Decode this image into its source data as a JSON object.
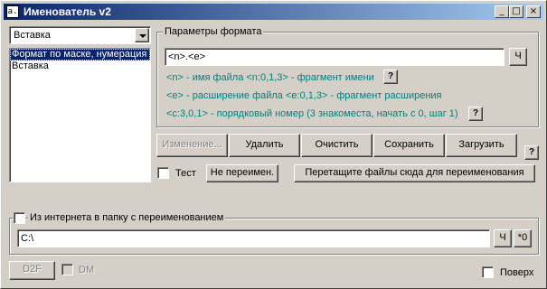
{
  "window": {
    "title": "Именователь v2",
    "icon": "app-icon",
    "icon_glyph": "a.",
    "controls": {
      "minimize": "_",
      "maximize": "□",
      "close": "×"
    }
  },
  "mode_select": {
    "value": "Вставка"
  },
  "mode_list": {
    "items": [
      {
        "label": "Формат по маске, нумерация",
        "selected": true
      },
      {
        "label": "Вставка",
        "selected": false
      }
    ]
  },
  "format_group": {
    "title": "Параметры формата",
    "mask_value": "<n>.<e>",
    "mask_button": "Ч",
    "hints": [
      {
        "text": "<n> - имя файла  <n:0,1,3> - фрагмент имени",
        "help": "?"
      },
      {
        "text": "<e> - расширение файла  <e:0,1,3> - фрагмент расширения",
        "help": ""
      },
      {
        "text": "<c:3,0,1> - порядковый номер (3 знакоместа, начать с 0, шаг 1)",
        "help": "?"
      }
    ],
    "hint_color": "#008080"
  },
  "actions": {
    "change": "Изменение...",
    "delete": "Удалить",
    "clear": "Очистить",
    "save": "Сохранить",
    "load": "Загрузить",
    "help": "?"
  },
  "test_checkbox": {
    "label": "Тест",
    "checked": false
  },
  "no_rename_button": "Не переимен.",
  "drop_button": "Перетащите файлы сюда для переименования",
  "internet_group": {
    "title": "Из интернета в папку с переименованием",
    "checked": false,
    "path_value": "C:\\",
    "button_ch": "Ч",
    "button_star0": "*0"
  },
  "bottom": {
    "d2f_button": "D2F",
    "dm_label": "DM",
    "dm_checked": false,
    "on_top_label": "Поверх",
    "on_top_checked": false
  },
  "colors": {
    "title_gradient_start": "#0a246a",
    "title_gradient_end": "#a6caf0",
    "face": "#d4d0c8",
    "selection": "#0a246a"
  }
}
